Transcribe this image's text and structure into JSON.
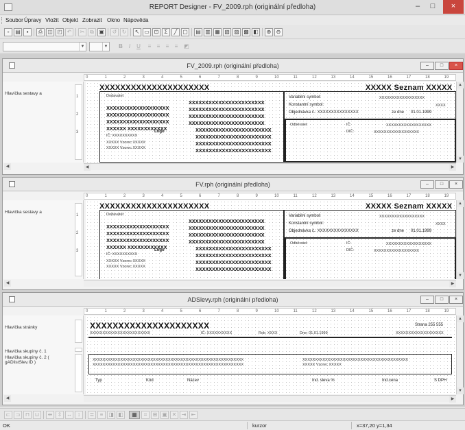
{
  "app": {
    "title": "REPORT Designer - FV_2009.rph (originální předloha)"
  },
  "window_controls": {
    "min": "–",
    "max": "□",
    "close": "×"
  },
  "menu": [
    "Soubor",
    "Úpravy",
    "Vložit",
    "Objekt",
    "Zobrazit",
    "Okno",
    "Nápověda"
  ],
  "format": {
    "bold": "B",
    "italic": "I",
    "underline": "U"
  },
  "child_controls": {
    "min": "–",
    "max": "□",
    "close": "×"
  },
  "ruler_labels": [
    "0",
    "1",
    "2",
    "3",
    "4",
    "5",
    "6",
    "7",
    "8",
    "9",
    "10",
    "11",
    "12",
    "13",
    "14",
    "15",
    "16",
    "17",
    "18",
    "19"
  ],
  "windows": [
    {
      "title": "FV_2009.rph (originální předloha)",
      "section": "Hlavička sestavy a"
    },
    {
      "title": "FV.rph (originální předloha)",
      "section": "Hlavička sestavy a"
    },
    {
      "title": "ADSlevy.rph (originální předloha)"
    }
  ],
  "invoice": {
    "xx_header": "XXXXXXXXXXXXXXXXXXXXX",
    "seznam": "XXXXX Seznam XXXXX",
    "dodavatel": "Dodavatel:",
    "logo": "Logo",
    "row_a": "XXXXXXXXXXXXXXXXXXX",
    "row_b": "XXXXXXXXXXXXXXXXXXXXXXX",
    "row_c": "XXXXXX XXXXXXXXXXXX",
    "ic": "IČ: XXXXXXXXXX",
    "vzorec": "XXXXX Vzorec XXXXX",
    "vs": "Variabilní symbol:",
    "ks": "Konstantní symbol:",
    "obj": "Objednávka č.: XXXXXXXXXXXXXXX",
    "ze_dne": "ze dne",
    "date": "01.01.1999",
    "odberatel": "Odběratel:",
    "ic2": "IČ:",
    "dic": "DIČ:",
    "val_long": "XXXXXXXXXXXXXXXXXX",
    "val_short": "XXXX"
  },
  "adslevy": {
    "sec_page": "Hlavička stránky",
    "sec_g1": "Hlavička skupiny č. 1",
    "sec_g2": "Hlavička skupiny č. 2 ( gADlistSlev.ID )",
    "big_x": "XXXXXXXXXXXXXXXXXXXXX",
    "strana": "Strana 255 555",
    "line1": "XXXXXXXXXXXXXXXXXXXXXXXX",
    "ic": "IČ: XXXXXXXXXX",
    "rok": "Rok: XXXX",
    "dne": "Dne: 01.01.1999",
    "xx_right": "XXXXXXXXXXXXXXXXXXX",
    "g2_l1": "XXXXXXXXXXXXXXXXXXXXXXXXXXXXXXXXXXXXXXXXXXXXXXXXXXXXXXXXXXXX",
    "g2_l2": "XXXXXXXXXXXXXXXXXXXXXXXXXXXXXXXXXXXXXXXXXXXXXXXXXXXXXXXXXXXX",
    "g2_r1": "XXXXXXXXXXXXXXXXXXXXXXXXXXXXXXXXXXXXXXXXXX",
    "g2_r2": "XXXXX Vzorec XXXXX",
    "col_typ": "Typ",
    "col_kod": "Kód",
    "col_nazev": "Název",
    "col_sleva": "Ind. sleva %",
    "col_cena": "Ind.cena",
    "col_dph": "S DPH"
  },
  "status": {
    "left": "OK",
    "mid": "kurzor",
    "pos": "x=37,20  y=1,34"
  }
}
